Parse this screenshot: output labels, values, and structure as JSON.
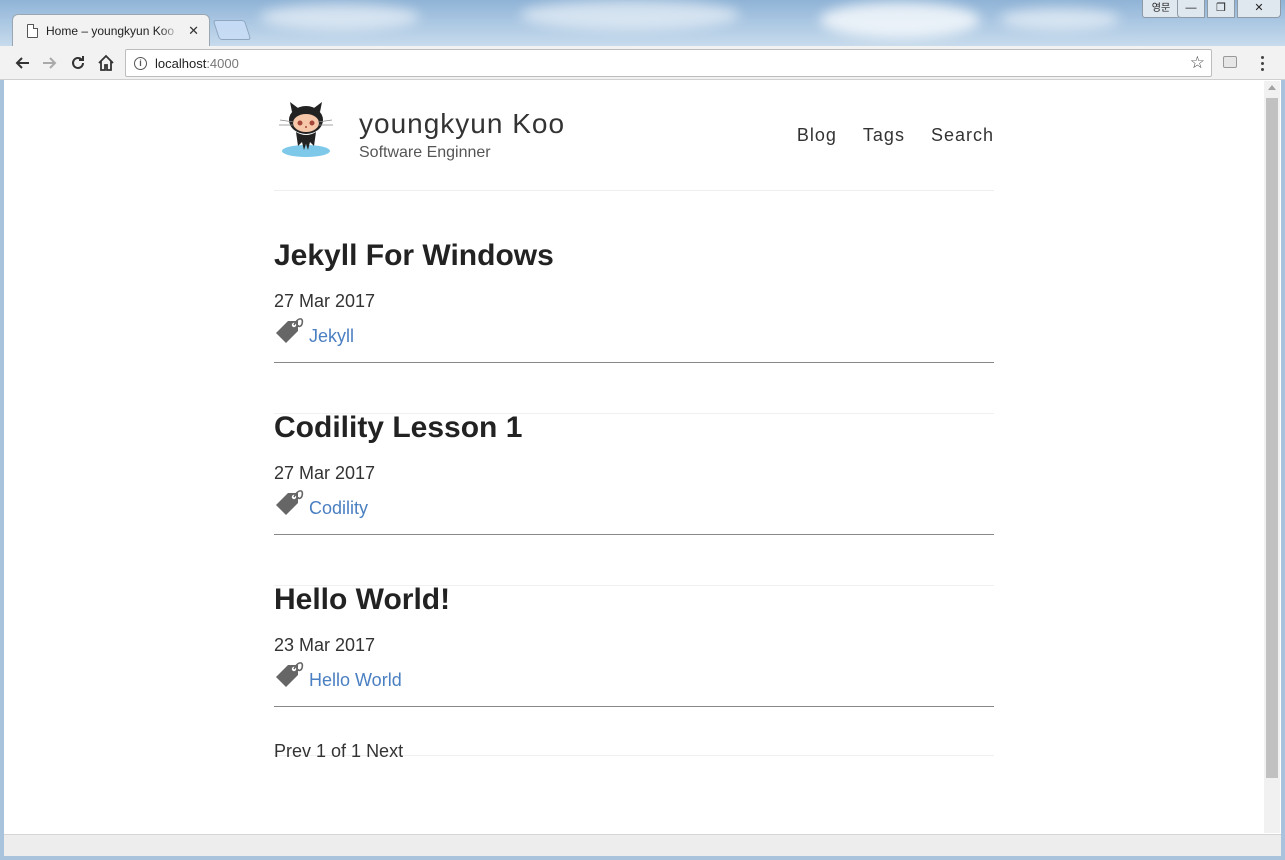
{
  "browser": {
    "tab_title": "Home – youngkyun Koo",
    "tab_close": "✕",
    "ime_indicator": "영문",
    "window_controls": {
      "minimize": "—",
      "maximize": "❐",
      "close": "✕"
    },
    "url_host": "localhost",
    "url_port": ":4000",
    "icons": [
      "back-arrow-icon",
      "forward-arrow-icon",
      "reload-icon",
      "home-icon",
      "info-icon",
      "star-icon",
      "menu-icon"
    ]
  },
  "site": {
    "title": "youngkyun Koo",
    "subtitle": "Software Enginner",
    "nav": [
      "Blog",
      "Tags",
      "Search"
    ]
  },
  "posts": [
    {
      "title": "Jekyll For Windows",
      "date": "27 Mar 2017",
      "tag": "Jekyll"
    },
    {
      "title": "Codility Lesson 1",
      "date": "27 Mar 2017",
      "tag": "Codility"
    },
    {
      "title": "Hello World!",
      "date": "23 Mar 2017",
      "tag": "Hello World"
    }
  ],
  "pagination": {
    "prev": "Prev",
    "current": "1",
    "of_label": "of",
    "total": "1",
    "next": "Next"
  },
  "colors": {
    "link": "#4a7fc1",
    "text": "#222222",
    "tag_icon": "#666666"
  }
}
